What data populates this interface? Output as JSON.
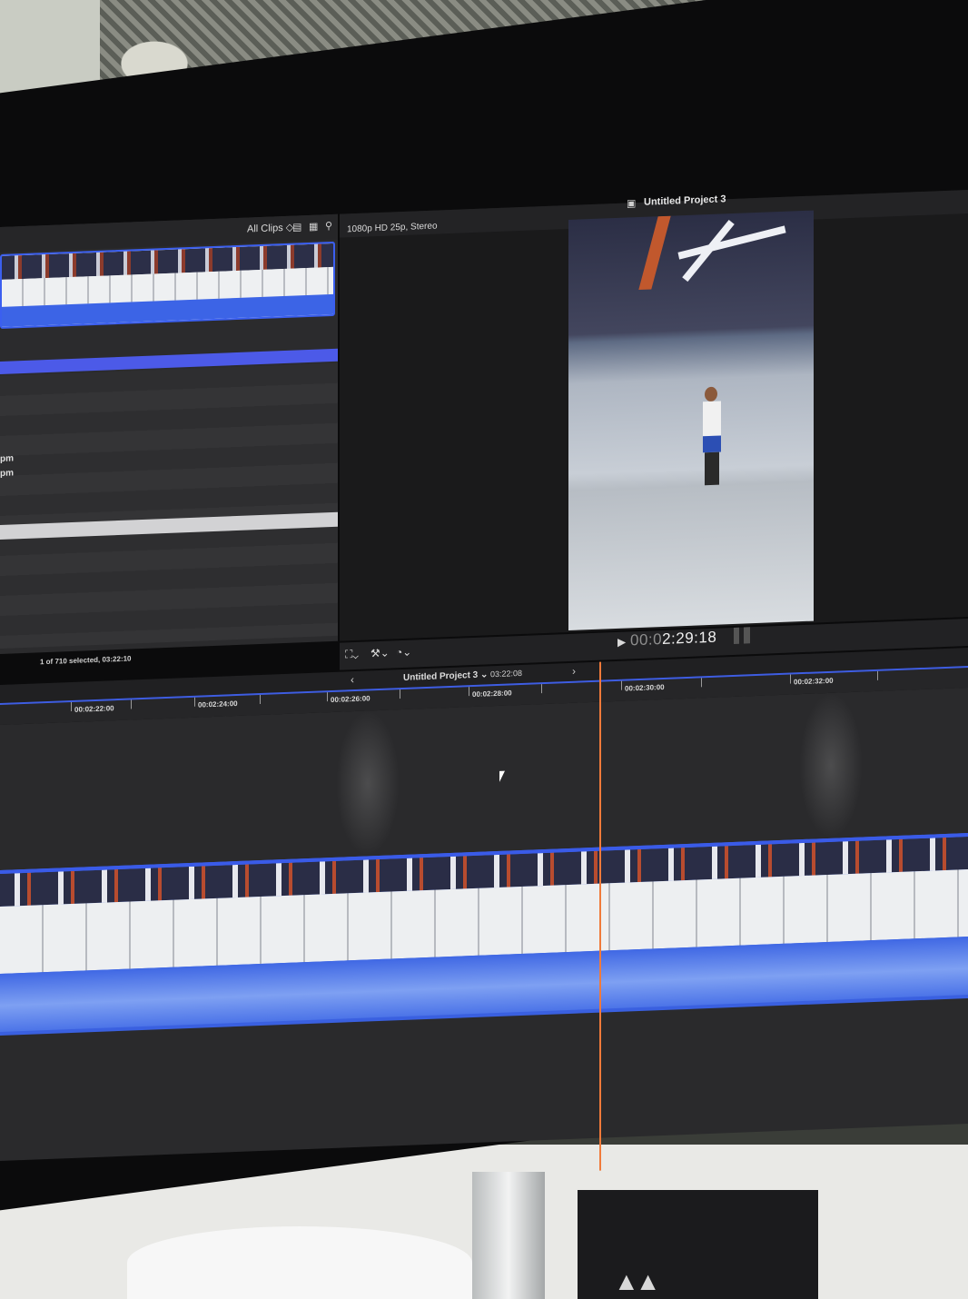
{
  "browser": {
    "filter_label": "All Clips ◇",
    "row_labels": [
      "pm",
      "pm"
    ],
    "selection_status": "1 of 710 selected, 03:22:10"
  },
  "viewer": {
    "format": "1080p HD 25p, Stereo",
    "project_title": "Untitled Project 3",
    "timecode_dim": "00:0",
    "timecode_main": "2:29:18"
  },
  "timeline": {
    "project_name": "Untitled Project 3 ⌄",
    "duration": "03:22:08",
    "ruler_ticks": [
      "00:02:22:00",
      "00:02:24:00",
      "00:02:26:00",
      "00:02:28:00",
      "00:02:30:00",
      "00:02:32:00"
    ]
  },
  "icons": {
    "filmstrip_view": "filmstrip-icon",
    "list_view": "list-icon",
    "search": "search-icon",
    "clapper": "clapper-icon",
    "transform": "crop-icon",
    "enhance": "magic-wand-icon",
    "speed": "speedometer-icon",
    "play": "play-icon",
    "prev": "chevron-left-icon",
    "next": "chevron-right-icon"
  },
  "colors": {
    "accent_blue": "#3e5de2",
    "playhead": "#f07a3a",
    "audio_waveform": "#4c74e8"
  }
}
